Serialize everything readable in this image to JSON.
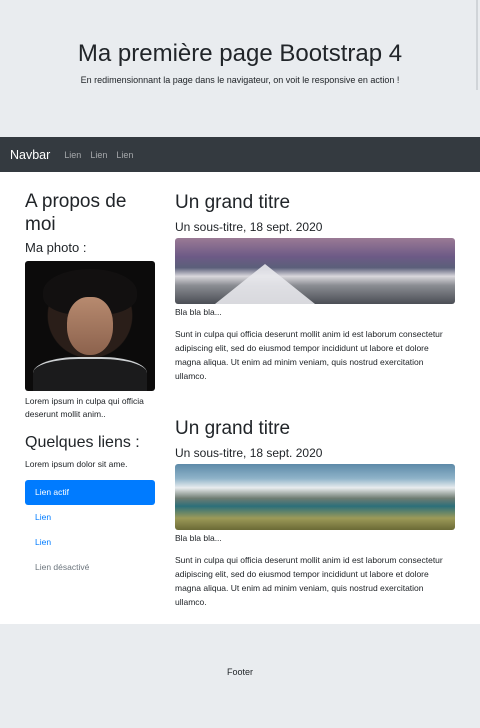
{
  "jumbotron": {
    "title": "Ma première page Bootstrap 4",
    "lead": "En redimensionnant la page dans le navigateur, on voit le responsive en action !"
  },
  "navbar": {
    "brand": "Navbar",
    "links": [
      "Lien",
      "Lien",
      "Lien"
    ]
  },
  "sidebar": {
    "about_title": "A propos de moi",
    "photo_label": "Ma photo :",
    "photo_text": "Lorem ipsum in culpa qui officia deserunt mollit anim..",
    "links_title": "Quelques liens :",
    "links_text": "Lorem ipsum dolor sit ame.",
    "nav": [
      "Lien actif",
      "Lien",
      "Lien",
      "Lien désactivé"
    ]
  },
  "articles": [
    {
      "title": "Un grand titre",
      "subtitle": "Un sous-titre, 18 sept. 2020",
      "caption": "Bla bla bla...",
      "text": "Sunt in culpa qui officia deserunt mollit anim id est laborum consectetur adipiscing elit, sed do eiusmod tempor incididunt ut labore et dolore magna aliqua. Ut enim ad minim veniam, quis nostrud exercitation ullamco."
    },
    {
      "title": "Un grand titre",
      "subtitle": "Un sous-titre, 18 sept. 2020",
      "caption": "Bla bla bla...",
      "text": "Sunt in culpa qui officia deserunt mollit anim id est laborum consectetur adipiscing elit, sed do eiusmod tempor incididunt ut labore et dolore magna aliqua. Ut enim ad minim veniam, quis nostrud exercitation ullamco."
    }
  ],
  "footer": {
    "text": "Footer"
  },
  "colors": {
    "primary": "#007bff",
    "navbar": "#343a40",
    "jumbotron": "#e9ecef"
  }
}
